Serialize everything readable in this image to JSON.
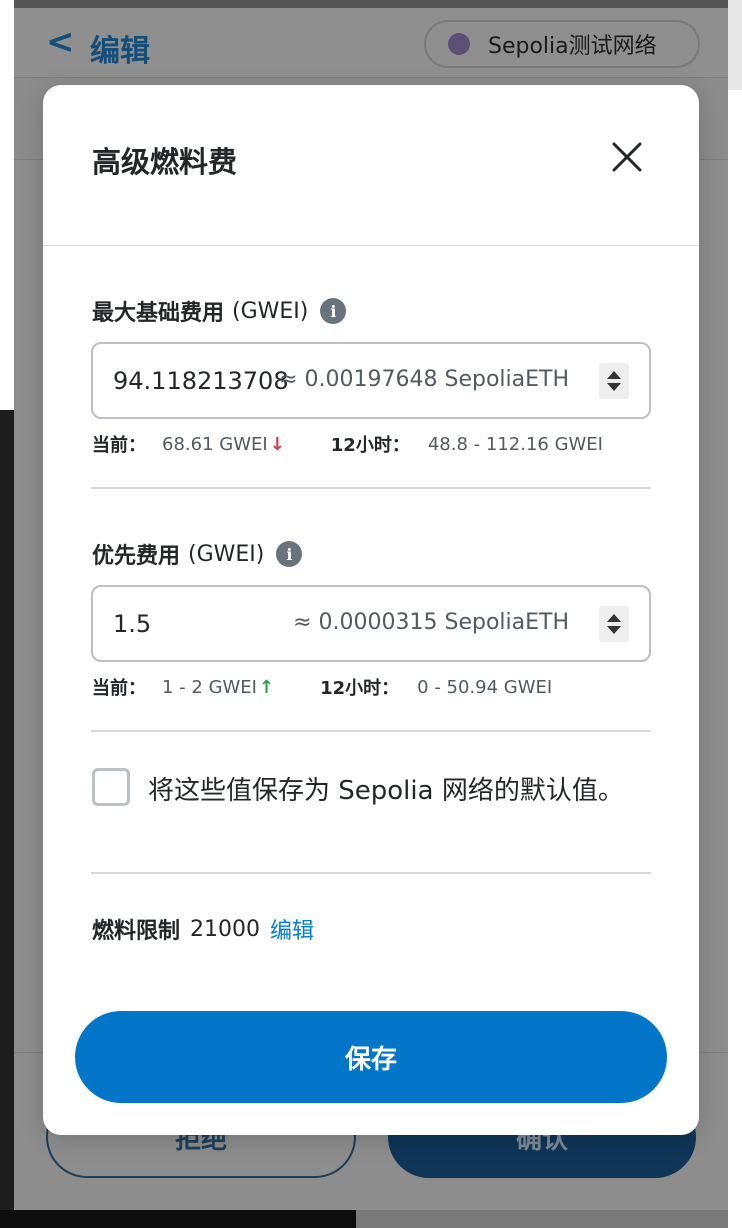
{
  "background": {
    "header": {
      "back_glyph": "<",
      "title": "编辑"
    },
    "network": {
      "label": "Sepolia测试网络",
      "dot_color": "#5e4f75"
    },
    "footer": {
      "reject_label": "拒绝",
      "confirm_label": "确认"
    }
  },
  "modal": {
    "title": "高级燃料费",
    "close_glyph": "close-icon",
    "max_base_fee": {
      "label": "最大基础费用",
      "unit": "(GWEI)",
      "value": "94.118213708",
      "conversion": "≈ 0.00197648 SepoliaETH",
      "current_key": "当前：",
      "current_value": "68.61 GWEI",
      "trend": "↓",
      "range_key": "12小时：",
      "range_value": "48.8 - 112.16 GWEI"
    },
    "priority_fee": {
      "label": "优先费用",
      "unit": "(GWEI)",
      "value": "1.5",
      "conversion": "≈ 0.0000315 SepoliaETH",
      "current_key": "当前：",
      "current_value": "1 - 2 GWEI",
      "trend": "↑",
      "range_key": "12小时：",
      "range_value": "0 - 50.94 GWEI"
    },
    "save_default": {
      "label": "将这些值保存为 Sepolia 网络的默认值。",
      "checked": false
    },
    "gas_limit": {
      "label": "燃料限制",
      "value": "21000",
      "edit_label": "编辑"
    },
    "save_label": "保存"
  },
  "colors": {
    "primary": "#0376c9",
    "link": "#037dd6",
    "trend_down": "#d73847",
    "trend_up": "#28a745"
  }
}
